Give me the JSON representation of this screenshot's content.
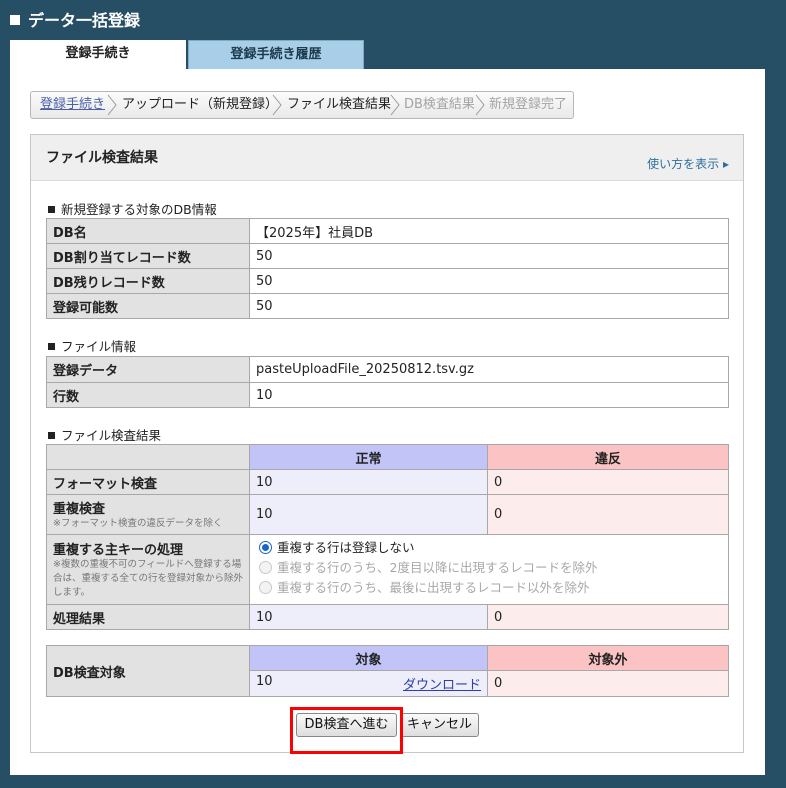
{
  "header": {
    "title": "データ一括登録"
  },
  "tabs": {
    "active": "登録手続き",
    "history": "登録手続き履歴"
  },
  "breadcrumb": {
    "step1": "登録手続き",
    "step2": "アップロード（新規登録）",
    "step3": "ファイル検査結果",
    "step4": "DB検査結果",
    "step5": "新規登録完了"
  },
  "card": {
    "title": "ファイル検査結果",
    "help": "使い方を表示 ▸"
  },
  "db_info": {
    "title": "新規登録する対象のDB情報",
    "rows": [
      {
        "label": "DB名",
        "value": "【2025年】社員DB"
      },
      {
        "label": "DB割り当てレコード数",
        "value": "50"
      },
      {
        "label": "DB残りレコード数",
        "value": "50"
      },
      {
        "label": "登録可能数",
        "value": "50"
      }
    ]
  },
  "file_info": {
    "title": "ファイル情報",
    "rows": [
      {
        "label": "登録データ",
        "value": "pasteUploadFile_20250812.tsv.gz"
      },
      {
        "label": "行数",
        "value": "10"
      }
    ]
  },
  "check": {
    "title": "ファイル検査結果",
    "col_ok": "正常",
    "col_ng": "違反",
    "format_label": "フォーマット検査",
    "format_ok": "10",
    "format_ng": "0",
    "dup_label": "重複検査",
    "dup_note": "※フォーマット検査の違反データを除く",
    "dup_ok": "10",
    "dup_ng": "0",
    "key_label": "重複する主キーの処理",
    "key_note": "※複数の重複不可のフィールドへ登録する場合は、重複する全ての行を登録対象から除外します。",
    "options": [
      "重複する行は登録しない",
      "重複する行のうち、2度目以降に出現するレコードを除外",
      "重複する行のうち、最後に出現するレコード以外を除外"
    ],
    "result_label": "処理結果",
    "result_ok": "10",
    "result_ng": "0"
  },
  "target": {
    "label": "DB検査対象",
    "col_target": "対象",
    "col_excluded": "対象外",
    "target_count": "10",
    "download": "ダウンロード",
    "excluded_count": "0"
  },
  "buttons": {
    "proceed": "DB検査へ進む",
    "cancel": "キャンセル"
  },
  "colors": {
    "background": "#264e64",
    "tab_inactive": "#a9cfe8",
    "ok_header": "#c2c4f8",
    "ng_header": "#fbc3c3",
    "highlight": "#ff0000"
  }
}
